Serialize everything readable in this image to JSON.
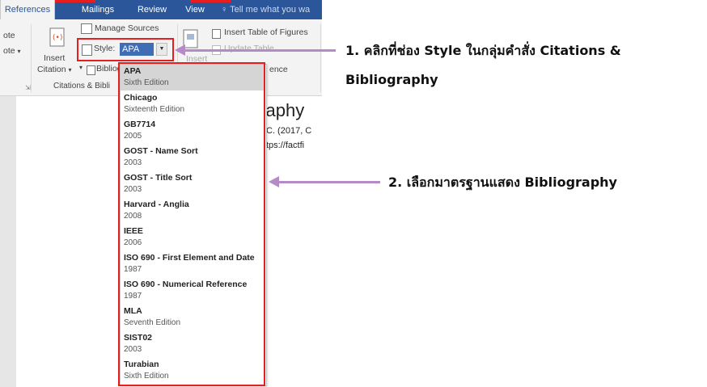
{
  "ribbon": {
    "tabs": [
      "References",
      "Mailings",
      "Review",
      "View"
    ],
    "tell_me": "Tell me what you wa",
    "partial_left": [
      "ote",
      "ote"
    ],
    "insert_citation": [
      "Insert",
      "Citation"
    ],
    "manage_sources": "Manage Sources",
    "style_label": "Style:",
    "style_value": "APA",
    "bibliography": "Bibliog",
    "insert_label": "Insert",
    "insert_table_of_figures": "Insert Table of Figures",
    "update_table": "Update Table",
    "ence": "ence",
    "group_label": "Citations & Bibli"
  },
  "document": {
    "heading": "graphy",
    "lines": [
      "C. (2017, C",
      "tps://factfi"
    ]
  },
  "dropdown": {
    "items": [
      {
        "name": "APA",
        "sub": "Sixth Edition"
      },
      {
        "name": "Chicago",
        "sub": "Sixteenth Edition"
      },
      {
        "name": "GB7714",
        "sub": "2005"
      },
      {
        "name": "GOST - Name Sort",
        "sub": "2003"
      },
      {
        "name": "GOST - Title Sort",
        "sub": "2003"
      },
      {
        "name": "Harvard - Anglia",
        "sub": "2008"
      },
      {
        "name": "IEEE",
        "sub": "2006"
      },
      {
        "name": "ISO 690 - First Element and Date",
        "sub": "1987"
      },
      {
        "name": "ISO 690 - Numerical Reference",
        "sub": "1987"
      },
      {
        "name": "MLA",
        "sub": "Seventh Edition"
      },
      {
        "name": "SIST02",
        "sub": "2003"
      },
      {
        "name": "Turabian",
        "sub": "Sixth Edition"
      }
    ]
  },
  "annotations": {
    "note1_line1": "1. คลิกที่ช่อง Style ในกลุ่มคำสั่ง Citations &",
    "note1_line2": "Bibliography",
    "note2": "2. เลือกมาตรฐานแสดง Bibliography"
  },
  "colors": {
    "ribbon_blue": "#2b579a",
    "highlight_red": "#e81e1e",
    "arrow_purple": "#b58ac6",
    "selected_value": "#3f6eb5"
  }
}
